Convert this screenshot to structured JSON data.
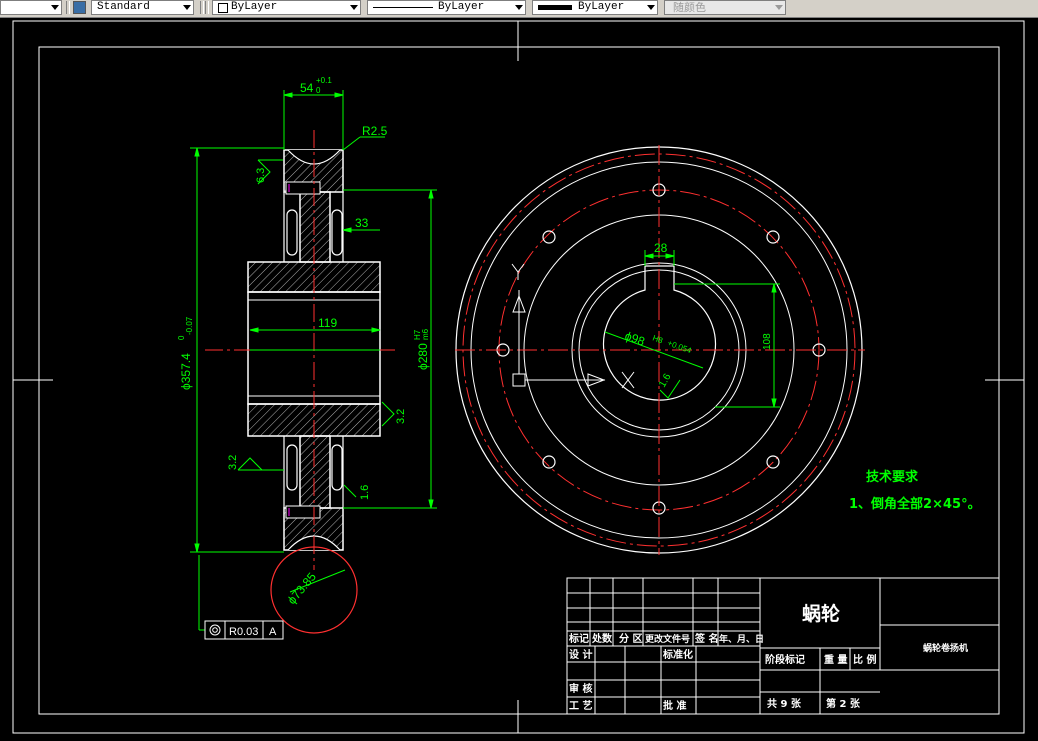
{
  "toolbar": {
    "text_style": "Standard",
    "layer": "ByLayer",
    "linetype": "ByLayer",
    "lineweight": "ByLayer",
    "plot_style": "随颜色"
  },
  "drawing": {
    "dims": {
      "width_54": "54",
      "width_54_tol_upper": "+0.1",
      "width_54_tol_lower": "0",
      "r25": "R2.5",
      "rough_63": "6.3",
      "dim_33": "33",
      "dim_119": "119",
      "dia_357": "ϕ357.4",
      "dia_357_tol": "0",
      "dia_357_tol2": "-0.07",
      "dia_280": "ϕ280",
      "dia_280_tol": "H7",
      "dia_280_tol2": "m6",
      "rough_32a": "3.2",
      "rough_32b": "3.2",
      "rough_16a": "1.6",
      "dia_7385": "ϕ73.85",
      "tol_value": "R0.03",
      "tol_datum": "A",
      "dim_28": "28",
      "dim_108": "108",
      "dia_98": "ϕ98",
      "dia_98_tol": "H8",
      "dia_98_tol2": "+0.054",
      "rough_16b": "1.6",
      "axis_x": "X",
      "axis_y": "Y"
    },
    "notes": {
      "title": "技术要求",
      "line1": "1、倒角全部2×45°。"
    }
  },
  "title_block": {
    "part_name": "蜗轮",
    "company": "蜗轮卷扬机",
    "h_mark": "标记",
    "h_count": "处数",
    "h_zone": "分 区",
    "h_doc": "更改文件号",
    "h_sign": "签 名",
    "h_date": "年、月、日",
    "design": "设 计",
    "standardize": "标准化",
    "stage": "阶段标记",
    "weight": "重 量",
    "scale": "比 例",
    "review": "审 核",
    "process": "工 艺",
    "approve": "批 准",
    "sheets_total": "共 9 张",
    "sheet_num": "第 2 张"
  }
}
